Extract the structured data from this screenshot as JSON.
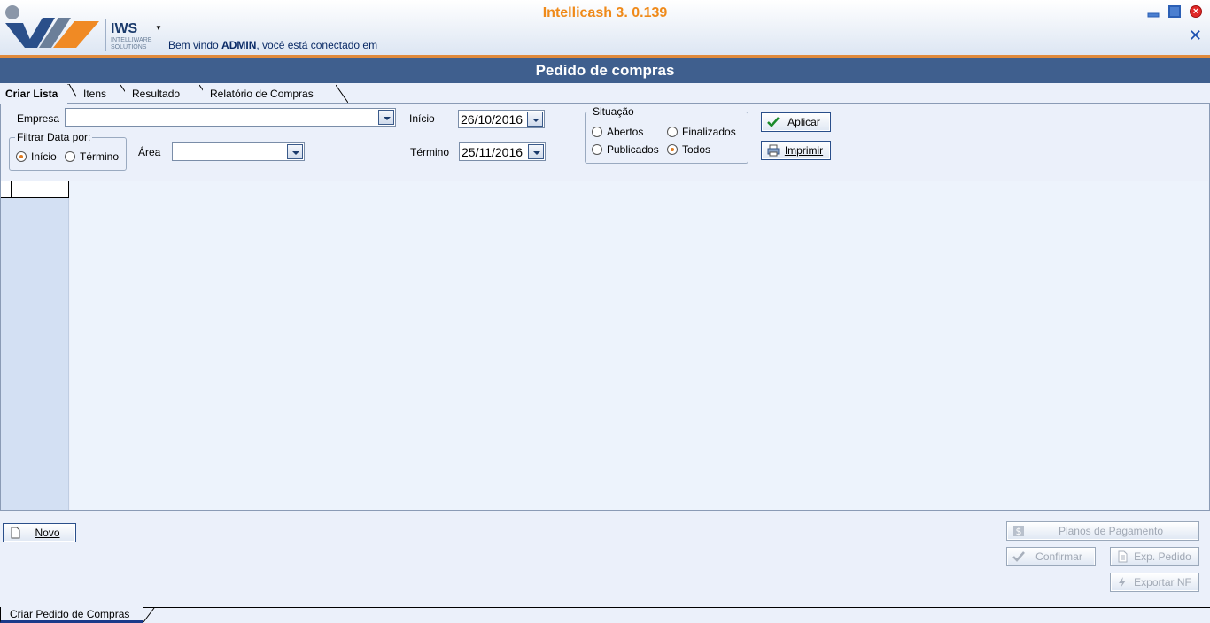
{
  "header": {
    "app_title": "Intellicash 3. 0.139",
    "brand": "IWS",
    "brand_sub": "INTELLIWARE SOLUTIONS",
    "welcome_prefix": "Bem vindo ",
    "welcome_user": "ADMIN",
    "welcome_suffix": ", você está conectado em"
  },
  "page_title": "Pedido de compras",
  "tabs": [
    {
      "label": "Criar Lista"
    },
    {
      "label": "Itens"
    },
    {
      "label": "Resultado"
    },
    {
      "label": "Relatório de Compras"
    }
  ],
  "form": {
    "empresa_label": "Empresa",
    "empresa_value": "",
    "filtrar_title": "Filtrar Data por:",
    "filtrar_inicio": "Início",
    "filtrar_termino": "Término",
    "area_label": "Área",
    "area_value": "",
    "inicio_label": "Início",
    "inicio_value": "26/10/2016",
    "termino_label": "Término",
    "termino_value": "25/11/2016",
    "situacao_title": "Situação",
    "situacao_abertos": "Abertos",
    "situacao_finalizados": "Finalizados",
    "situacao_publicados": "Publicados",
    "situacao_todos": "Todos",
    "aplicar_label": "Aplicar",
    "imprimir_label": "Imprimir"
  },
  "footer": {
    "novo_label": "Novo",
    "planos_label": "Planos de Pagamento",
    "confirmar_label": "Confirmar",
    "exp_pedido_label": "Exp. Pedido",
    "exportar_nf_label": "Exportar NF",
    "bottom_tab_label": "Criar Pedido de Compras"
  },
  "colors": {
    "accent_orange": "#ef8a1a",
    "titlebar_blue": "#3f5f8e",
    "brand_blue": "#1a3a6b"
  }
}
